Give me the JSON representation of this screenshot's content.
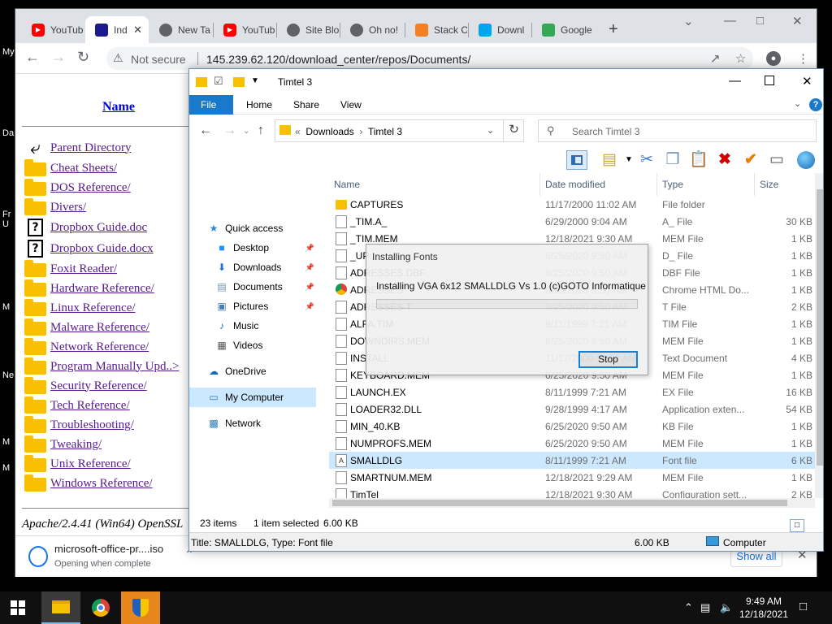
{
  "desktop": {
    "side_text": [
      "My",
      "Da",
      "Fr",
      "U",
      "M",
      "Ne",
      "M",
      "M"
    ]
  },
  "browser": {
    "tabs": [
      {
        "label": "YouTub",
        "favicon": "youtube-icon",
        "color": "#ff0000"
      },
      {
        "label": "Ind",
        "favicon": "page-icon",
        "color": "#1a1a8e"
      },
      {
        "label": "New Ta",
        "favicon": "chrome-icon",
        "color": "#5f6368"
      },
      {
        "label": "YouTub",
        "favicon": "youtube-icon",
        "color": "#ff0000"
      },
      {
        "label": "Site Blo",
        "favicon": "globe-icon",
        "color": "#5f6368"
      },
      {
        "label": "Oh no!",
        "favicon": "face-icon",
        "color": "#5f6368"
      },
      {
        "label": "Stack O",
        "favicon": "stack-icon",
        "color": "#f48024"
      },
      {
        "label": "Downl",
        "favicon": "windows-icon",
        "color": "#00a4ef"
      },
      {
        "label": "Google",
        "favicon": "download-icon",
        "color": "#34a853"
      }
    ],
    "not_secure": "Not secure",
    "url": "145.239.62.120/download_center/repos/Documents/"
  },
  "listing": {
    "column_name": "Name",
    "items": [
      {
        "label": "Parent Directory",
        "icon": "back-arrow-icon"
      },
      {
        "label": "Cheat Sheets/",
        "icon": "folder-icon"
      },
      {
        "label": "DOS Reference/",
        "icon": "folder-icon"
      },
      {
        "label": "Divers/",
        "icon": "folder-icon"
      },
      {
        "label": "Dropbox Guide.doc",
        "icon": "unknown-file-icon"
      },
      {
        "label": "Dropbox Guide.docx",
        "icon": "unknown-file-icon"
      },
      {
        "label": "Foxit Reader/",
        "icon": "folder-icon"
      },
      {
        "label": "Hardware Reference/",
        "icon": "folder-icon"
      },
      {
        "label": "Linux Reference/",
        "icon": "folder-icon"
      },
      {
        "label": "Malware Reference/",
        "icon": "folder-icon"
      },
      {
        "label": "Network Reference/",
        "icon": "folder-icon"
      },
      {
        "label": "Program Manually Upd..>",
        "icon": "folder-icon"
      },
      {
        "label": "Security Reference/",
        "icon": "folder-icon"
      },
      {
        "label": "Tech Reference/",
        "icon": "folder-icon"
      },
      {
        "label": "Troubleshooting/",
        "icon": "folder-icon"
      },
      {
        "label": "Tweaking/",
        "icon": "folder-icon"
      },
      {
        "label": "Unix Reference/",
        "icon": "folder-icon"
      },
      {
        "label": "Windows Reference/",
        "icon": "folder-icon"
      }
    ],
    "footer": "Apache/2.4.41 (Win64) OpenSSL"
  },
  "download": {
    "filename": "microsoft-office-pr....iso",
    "status": "Opening when complete",
    "show_all": "Show all"
  },
  "explorer": {
    "title": "Timtel 3",
    "ribbon_tabs": [
      "File",
      "Home",
      "Share",
      "View"
    ],
    "breadcrumb": [
      "Downloads",
      "Timtel 3"
    ],
    "search_placeholder": "Search Timtel 3",
    "nav": [
      {
        "label": "Quick access",
        "icon": "star-icon",
        "indent": 0,
        "pinned": false
      },
      {
        "label": "Desktop",
        "icon": "desktop-icon",
        "indent": 1,
        "pinned": true
      },
      {
        "label": "Downloads",
        "icon": "download-arrow-icon",
        "indent": 1,
        "pinned": true
      },
      {
        "label": "Documents",
        "icon": "documents-icon",
        "indent": 1,
        "pinned": true
      },
      {
        "label": "Pictures",
        "icon": "pictures-icon",
        "indent": 1,
        "pinned": true
      },
      {
        "label": "Music",
        "icon": "music-icon",
        "indent": 1,
        "pinned": false
      },
      {
        "label": "Videos",
        "icon": "videos-icon",
        "indent": 1,
        "pinned": false
      },
      {
        "label": "OneDrive",
        "icon": "cloud-icon",
        "indent": 0,
        "pinned": false
      },
      {
        "label": "My Computer",
        "icon": "computer-icon",
        "indent": 0,
        "pinned": false
      },
      {
        "label": "Network",
        "icon": "network-icon",
        "indent": 0,
        "pinned": false
      }
    ],
    "columns": {
      "name": "Name",
      "date": "Date modified",
      "type": "Type",
      "size": "Size"
    },
    "files": [
      {
        "name": "CAPTURES",
        "date": "11/17/2000 11:02 AM",
        "type": "File folder",
        "size": "",
        "icon": "folder"
      },
      {
        "name": "_TIM.A_",
        "date": "6/29/2000 9:04 AM",
        "type": "A_ File",
        "size": "30 KB",
        "icon": "file"
      },
      {
        "name": "_TIM.MEM",
        "date": "12/18/2021 9:30 AM",
        "type": "MEM File",
        "size": "1 KB",
        "icon": "file"
      },
      {
        "name": "_UP",
        "date": "6/25/2020 9:50 AM",
        "type": "D_ File",
        "size": "1 KB",
        "icon": "file"
      },
      {
        "name": "ADRESSES.DBF",
        "date": "6/25/2020 9:50 AM",
        "type": "DBF File",
        "size": "1 KB",
        "icon": "file"
      },
      {
        "name": "ADRESSES",
        "date": "6/25/2020 9:50 AM",
        "type": "Chrome HTML Do...",
        "size": "1 KB",
        "icon": "chrome"
      },
      {
        "name": "ADRESSES.T",
        "date": "6/25/2020 9:50 AM",
        "type": "T File",
        "size": "2 KB",
        "icon": "file"
      },
      {
        "name": "ALFA.TIM",
        "date": "8/11/1999 7:21 AM",
        "type": "TIM File",
        "size": "1 KB",
        "icon": "file"
      },
      {
        "name": "DOWNDIRS.MEM",
        "date": "6/25/2020 9:50 AM",
        "type": "MEM File",
        "size": "1 KB",
        "icon": "file"
      },
      {
        "name": "INSTALL",
        "date": "11/17/2000 11:00 AM",
        "type": "Text Document",
        "size": "4 KB",
        "icon": "file"
      },
      {
        "name": "KEYBOARD.MEM",
        "date": "6/25/2020 9:50 AM",
        "type": "MEM File",
        "size": "1 KB",
        "icon": "file"
      },
      {
        "name": "LAUNCH.EX",
        "date": "8/11/1999 7:21 AM",
        "type": "EX File",
        "size": "16 KB",
        "icon": "file"
      },
      {
        "name": "LOADER32.DLL",
        "date": "9/28/1999 4:17 AM",
        "type": "Application exten...",
        "size": "54 KB",
        "icon": "file"
      },
      {
        "name": "MIN_40.KB",
        "date": "6/25/2020 9:50 AM",
        "type": "KB File",
        "size": "1 KB",
        "icon": "file"
      },
      {
        "name": "NUMPROFS.MEM",
        "date": "6/25/2020 9:50 AM",
        "type": "MEM File",
        "size": "1 KB",
        "icon": "file"
      },
      {
        "name": "SMALLDLG",
        "date": "8/11/1999 7:21 AM",
        "type": "Font file",
        "size": "6 KB",
        "icon": "font"
      },
      {
        "name": "SMARTNUM.MEM",
        "date": "12/18/2021 9:29 AM",
        "type": "MEM File",
        "size": "1 KB",
        "icon": "file"
      },
      {
        "name": "TimTel",
        "date": "12/18/2021 9:30 AM",
        "type": "Configuration sett...",
        "size": "2 KB",
        "icon": "file"
      }
    ],
    "selected_index": 15,
    "status": {
      "count": "23 items",
      "selected": "1 item selected",
      "size": "6.00 KB"
    },
    "info": {
      "title": "Title: SMALLDLG, Type: Font file",
      "size": "6.00 KB",
      "location": "Computer"
    }
  },
  "dialog": {
    "title": "Installing Fonts",
    "message": "Installing VGA 6x12 SMALLDLG  Vs 1.0 (c)GOTO Informatique",
    "progress": 0,
    "stop": "Stop"
  },
  "taskbar": {
    "time": "9:49 AM",
    "date": "12/18/2021"
  }
}
